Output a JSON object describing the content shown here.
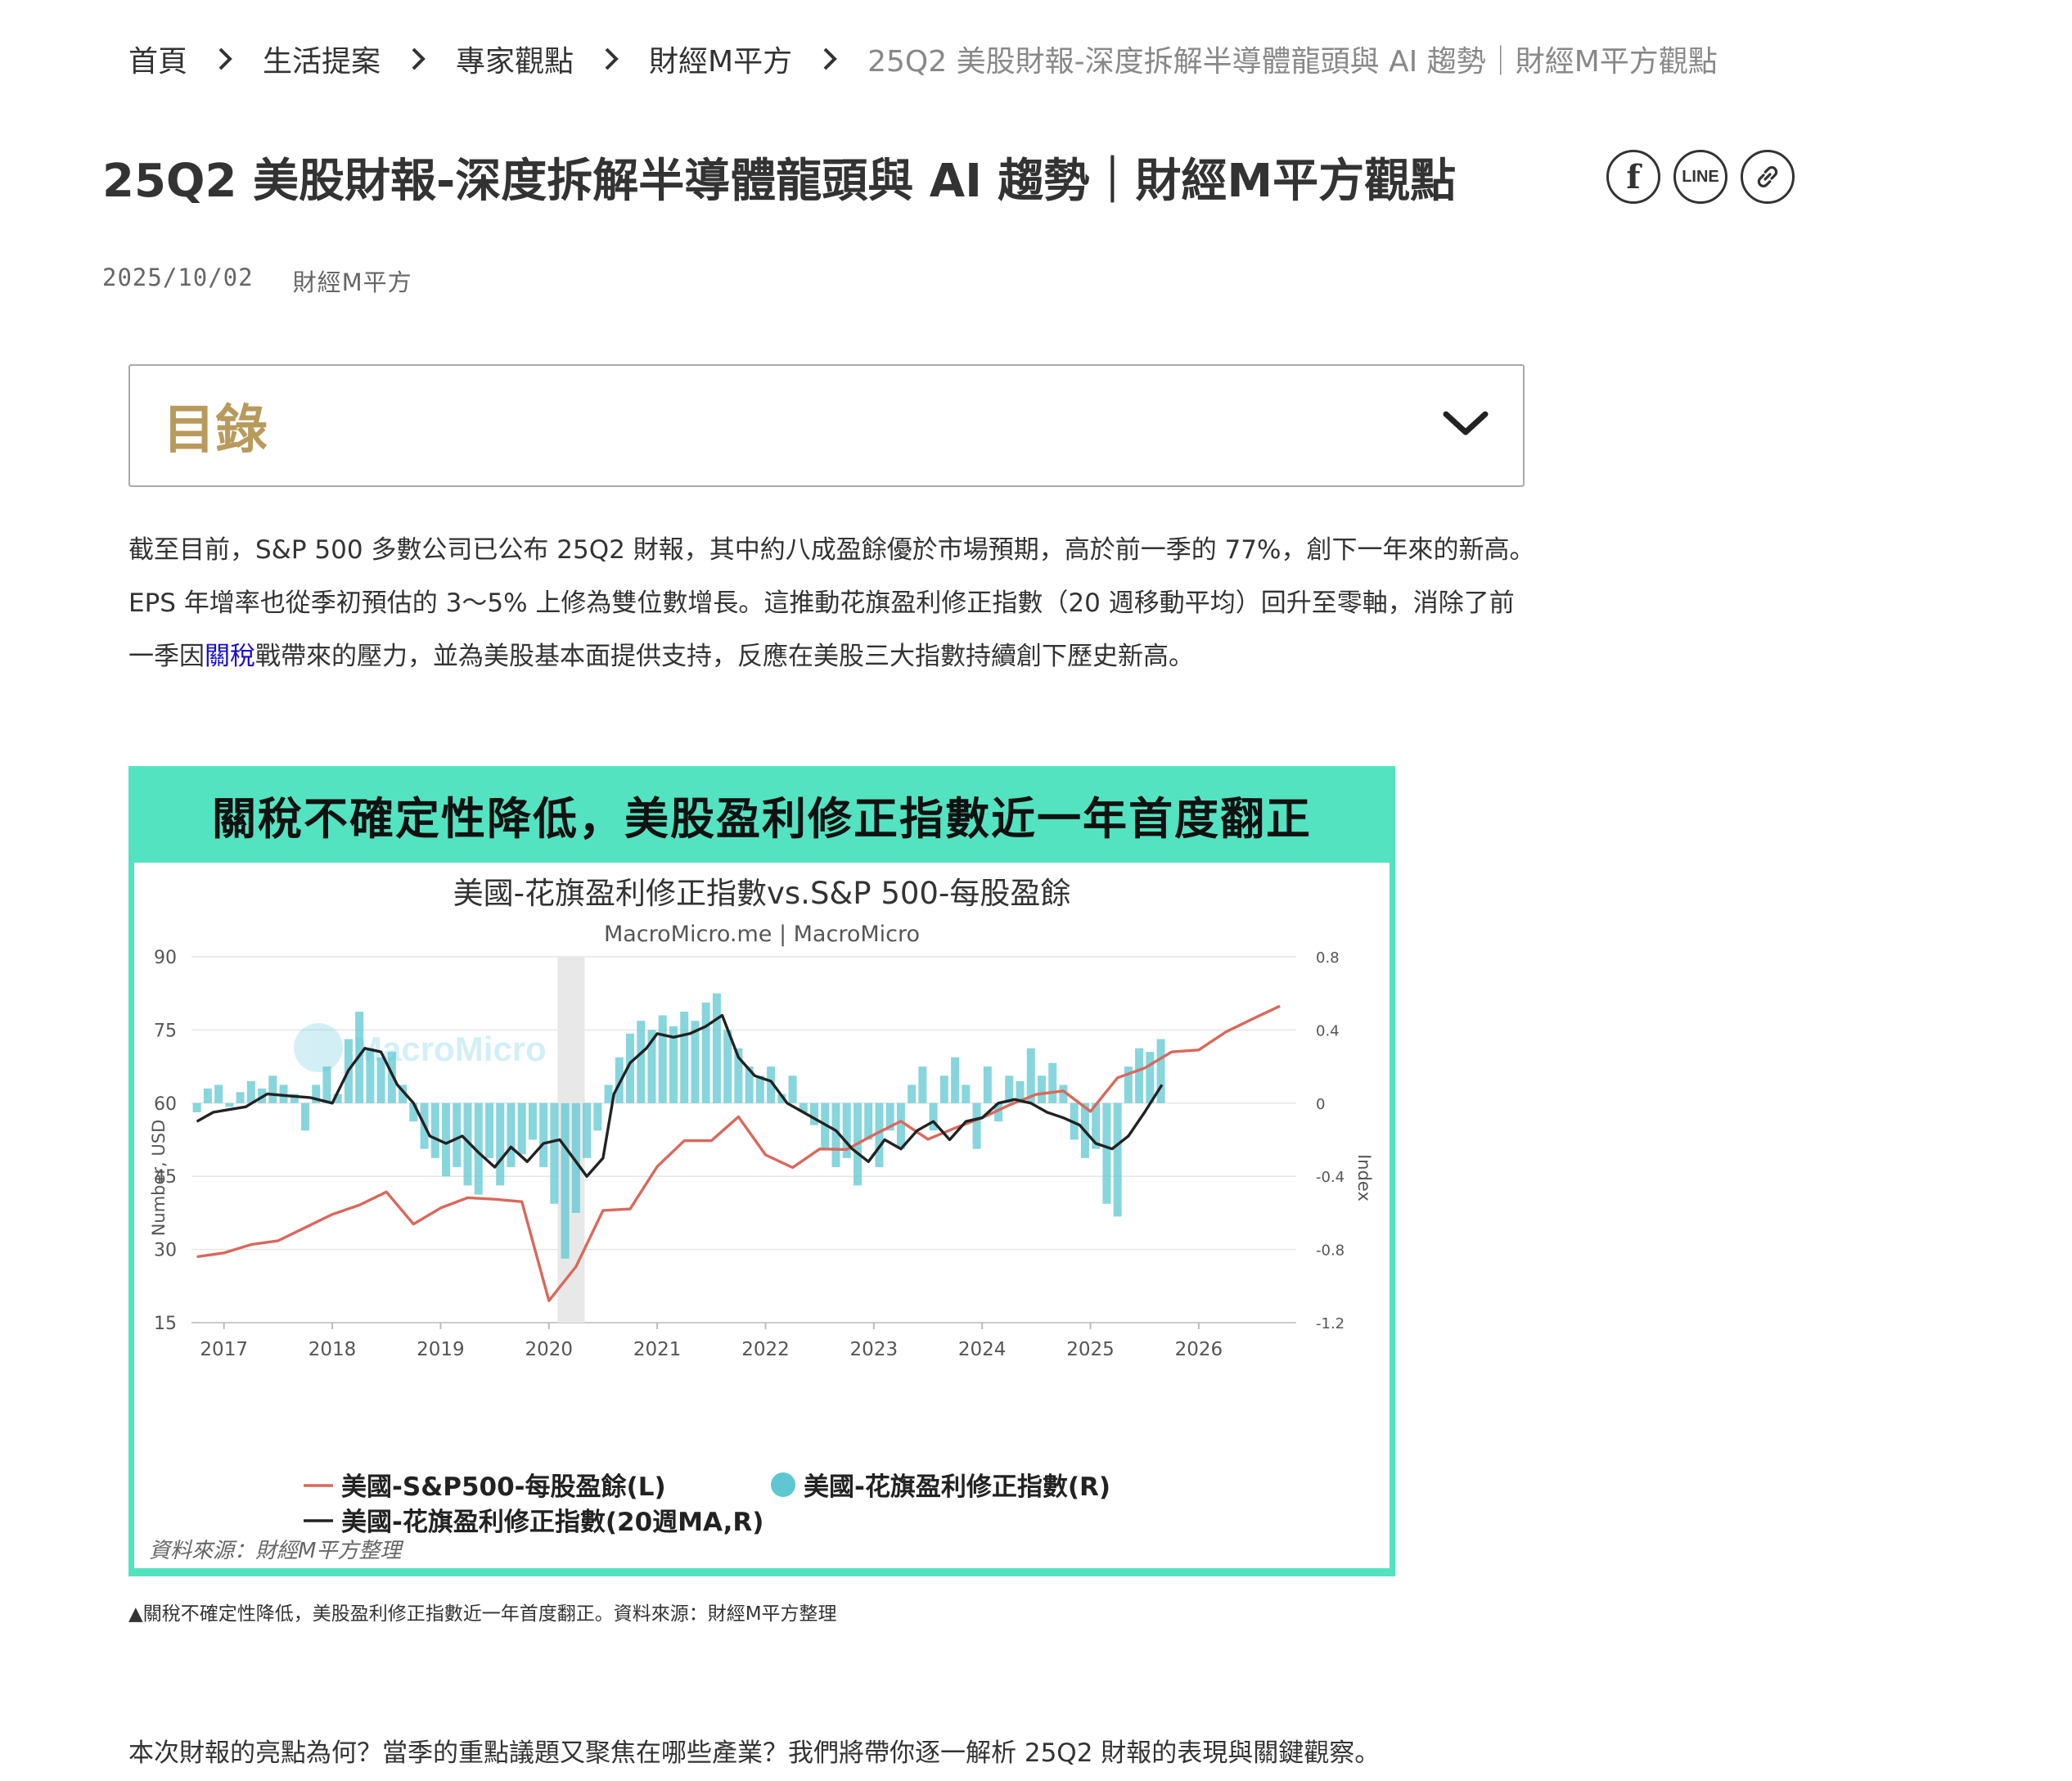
{
  "breadcrumb": {
    "items": [
      "首頁",
      "生活提案",
      "專家觀點",
      "財經M平方"
    ],
    "current": "25Q2 美股財報-深度拆解半導體龍頭與 AI 趨勢｜財經M平方觀點"
  },
  "article": {
    "title": "25Q2 美股財報-深度拆解半導體龍頭與 AI 趨勢｜財經M平方觀點",
    "date": "2025/10/02",
    "author": "財經M平方"
  },
  "share": {
    "facebook_label": "f",
    "line_label": "LINE"
  },
  "toc": {
    "title": "目錄"
  },
  "paragraph1": {
    "before_link": "截至目前，S&P 500 多數公司已公布 25Q2 財報，其中約八成盈餘優於市場預期，高於前一季的 77%，創下一年來的新高。EPS 年增率也從季初預估的 3～5% 上修為雙位數增長。這推動花旗盈利修正指數（20 週移動平均）回升至零軸，消除了前一季因",
    "link": "關稅",
    "after_link": "戰帶來的壓力，並為美股基本面提供支持，反應在美股三大指數持續創下歷史新高。"
  },
  "figure": {
    "banner": "關稅不確定性降低，美股盈利修正指數近一年首度翻正",
    "watermark": "MacroMicro",
    "source": "資料來源：財經M平方整理"
  },
  "caption": "▲關稅不確定性降低，美股盈利修正指數近一年首度翻正。資料來源：財經M平方整理",
  "paragraph2": "本次財報的亮點為何？當季的重點議題又聚焦在哪些產業？我們將帶你逐一解析 25Q2 財報的表現與關鍵觀察。",
  "colors": {
    "eps_line": "#d9685c",
    "ma_line": "#222222",
    "bars": "#5fc7d2",
    "frame": "#54e3c0",
    "toc_title": "#b89a5c",
    "recession_band": "#e8e8e8"
  },
  "chart_data": {
    "type": "line",
    "title": "美國-花旗盈利修正指數vs.S&P 500-每股盈餘",
    "subtitle": "MacroMicro.me | MacroMicro",
    "ylabel_left": "Number, USD",
    "ylabel_right": "Index",
    "ylim_left": [
      15,
      90
    ],
    "ylim_right": [
      -1.2,
      0.8
    ],
    "yticks_left": [
      "90",
      "75",
      "60",
      "45",
      "30",
      "15"
    ],
    "yticks_right": [
      "0.8",
      "0.4",
      "0",
      "-0.4",
      "-0.8",
      "-1.2"
    ],
    "xlim": [
      2016.7,
      2026.9
    ],
    "xticks": [
      "2017",
      "2018",
      "2019",
      "2020",
      "2021",
      "2022",
      "2023",
      "2024",
      "2025",
      "2026"
    ],
    "shaded_period": [
      2020.08,
      2020.33
    ],
    "legend": [
      "美國-S&P500-每股盈餘(L)",
      "美國-花旗盈利修正指數(R)",
      "美國-花旗盈利修正指數(20週MA,R)"
    ],
    "series": [
      {
        "name": "美國-S&P500-每股盈餘(L)",
        "axis": "left",
        "x": [
          2016.75,
          2017.0,
          2017.25,
          2017.5,
          2017.75,
          2018.0,
          2018.25,
          2018.5,
          2018.75,
          2019.0,
          2019.25,
          2019.5,
          2019.75,
          2020.0,
          2020.25,
          2020.5,
          2020.75,
          2021.0,
          2021.25,
          2021.5,
          2021.75,
          2022.0,
          2022.25,
          2022.5,
          2022.75,
          2023.0,
          2023.25,
          2023.5,
          2023.75,
          2024.0,
          2024.25,
          2024.5,
          2024.75,
          2025.0,
          2025.25,
          2025.5,
          2025.75,
          2026.0,
          2026.25,
          2026.5,
          2026.75
        ],
        "values": [
          28.5,
          29.3,
          31.0,
          31.8,
          34.5,
          37.2,
          39.1,
          41.8,
          35.2,
          38.5,
          40.6,
          40.3,
          39.8,
          19.5,
          26.5,
          38.0,
          38.3,
          47.0,
          52.3,
          52.3,
          57.2,
          49.4,
          46.8,
          50.6,
          50.5,
          53.5,
          56.3,
          52.6,
          54.9,
          57.0,
          59.6,
          61.8,
          62.5,
          58.3,
          65.2,
          67.2,
          70.5,
          70.9,
          74.6,
          77.3,
          79.9
        ]
      },
      {
        "name": "美國-花旗盈利修正指數(20週MA,R)",
        "axis": "right",
        "x": [
          2016.75,
          2016.9,
          2017.0,
          2017.2,
          2017.4,
          2017.6,
          2017.8,
          2018.0,
          2018.15,
          2018.3,
          2018.45,
          2018.6,
          2018.75,
          2018.9,
          2019.05,
          2019.2,
          2019.35,
          2019.5,
          2019.65,
          2019.8,
          2019.95,
          2020.1,
          2020.25,
          2020.35,
          2020.5,
          2020.6,
          2020.75,
          2020.9,
          2021.0,
          2021.15,
          2021.3,
          2021.45,
          2021.6,
          2021.75,
          2021.9,
          2022.05,
          2022.2,
          2022.35,
          2022.5,
          2022.65,
          2022.8,
          2022.95,
          2023.1,
          2023.25,
          2023.4,
          2023.55,
          2023.7,
          2023.85,
          2024.0,
          2024.15,
          2024.3,
          2024.45,
          2024.6,
          2024.75,
          2024.9,
          2025.05,
          2025.2,
          2025.35,
          2025.5,
          2025.66
        ],
        "values": [
          -0.1,
          -0.05,
          -0.04,
          -0.02,
          0.05,
          0.04,
          0.03,
          0.0,
          0.18,
          0.3,
          0.28,
          0.1,
          0.0,
          -0.18,
          -0.22,
          -0.18,
          -0.27,
          -0.35,
          -0.24,
          -0.32,
          -0.22,
          -0.2,
          -0.32,
          -0.4,
          -0.3,
          0.05,
          0.22,
          0.3,
          0.38,
          0.36,
          0.38,
          0.42,
          0.48,
          0.25,
          0.15,
          0.12,
          0.0,
          -0.05,
          -0.1,
          -0.15,
          -0.25,
          -0.32,
          -0.2,
          -0.25,
          -0.15,
          -0.1,
          -0.2,
          -0.1,
          -0.08,
          0.0,
          0.02,
          0.0,
          -0.05,
          -0.08,
          -0.12,
          -0.22,
          -0.25,
          -0.18,
          -0.05,
          0.1
        ]
      },
      {
        "name": "美國-花旗盈利修正指數(R)",
        "axis": "right",
        "type": "bar",
        "x": [
          2016.75,
          2016.85,
          2016.95,
          2017.05,
          2017.15,
          2017.25,
          2017.35,
          2017.45,
          2017.55,
          2017.65,
          2017.75,
          2017.85,
          2017.95,
          2018.05,
          2018.15,
          2018.25,
          2018.35,
          2018.45,
          2018.55,
          2018.65,
          2018.75,
          2018.85,
          2018.95,
          2019.05,
          2019.15,
          2019.25,
          2019.35,
          2019.45,
          2019.55,
          2019.65,
          2019.75,
          2019.85,
          2019.95,
          2020.05,
          2020.15,
          2020.25,
          2020.35,
          2020.45,
          2020.55,
          2020.65,
          2020.75,
          2020.85,
          2020.95,
          2021.05,
          2021.15,
          2021.25,
          2021.35,
          2021.45,
          2021.55,
          2021.65,
          2021.75,
          2021.85,
          2021.95,
          2022.05,
          2022.15,
          2022.25,
          2022.35,
          2022.45,
          2022.55,
          2022.65,
          2022.75,
          2022.85,
          2022.95,
          2023.05,
          2023.15,
          2023.25,
          2023.35,
          2023.45,
          2023.55,
          2023.65,
          2023.75,
          2023.85,
          2023.95,
          2024.05,
          2024.15,
          2024.25,
          2024.35,
          2024.45,
          2024.55,
          2024.65,
          2024.75,
          2024.85,
          2024.95,
          2025.05,
          2025.15,
          2025.25,
          2025.35,
          2025.45,
          2025.55,
          2025.65
        ],
        "values": [
          -0.05,
          0.08,
          0.1,
          -0.02,
          0.06,
          0.12,
          0.08,
          0.15,
          0.1,
          0.05,
          -0.15,
          0.1,
          0.2,
          0.05,
          0.35,
          0.5,
          0.3,
          0.25,
          0.28,
          0.1,
          -0.1,
          -0.25,
          -0.3,
          -0.4,
          -0.35,
          -0.45,
          -0.5,
          -0.3,
          -0.45,
          -0.35,
          -0.28,
          -0.2,
          -0.35,
          -0.55,
          -0.85,
          -0.6,
          -0.3,
          -0.15,
          0.1,
          0.25,
          0.38,
          0.45,
          0.4,
          0.48,
          0.42,
          0.5,
          0.45,
          0.55,
          0.6,
          0.4,
          0.3,
          0.2,
          0.15,
          0.2,
          0.05,
          0.15,
          -0.05,
          -0.12,
          -0.25,
          -0.35,
          -0.3,
          -0.45,
          -0.2,
          -0.35,
          -0.15,
          -0.25,
          0.1,
          0.2,
          -0.15,
          0.15,
          0.25,
          0.1,
          -0.25,
          0.2,
          -0.1,
          0.15,
          0.12,
          0.3,
          0.15,
          0.22,
          0.1,
          -0.2,
          -0.3,
          -0.25,
          -0.55,
          -0.62,
          0.2,
          0.3,
          0.28,
          0.35
        ]
      }
    ]
  }
}
